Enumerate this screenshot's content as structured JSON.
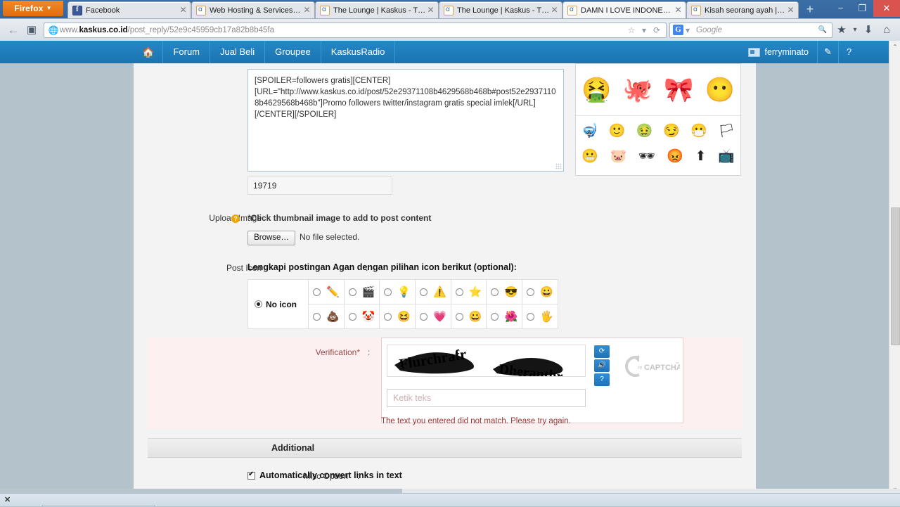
{
  "browser": {
    "menu_button": "Firefox",
    "menu_caret": "▼",
    "tabs": [
      {
        "title": "Facebook",
        "favicon": "facebook-icon",
        "active": false
      },
      {
        "title": "Web Hosting & Services |...",
        "favicon": "kaskus-icon",
        "active": false
      },
      {
        "title": "The Lounge | Kaskus - Th...",
        "favicon": "kaskus-icon",
        "active": false
      },
      {
        "title": "The Lounge | Kaskus - Th...",
        "favicon": "kaskus-icon",
        "active": false
      },
      {
        "title": "DAMN I LOVE INDONESI...",
        "favicon": "kaskus-icon",
        "active": true
      },
      {
        "title": "Kisah seorang ayah | Kas...",
        "favicon": "kaskus-icon",
        "active": false
      }
    ],
    "tab_close_glyph": "✕",
    "new_tab_label": "+",
    "window_minimize": "−",
    "window_restore": "❐",
    "window_close": "✕",
    "back_glyph": "←",
    "url_prefix": "www.",
    "url_domain": "kaskus.co.id",
    "url_path": "/post_reply/52e9c45959cb17a82b8b45fa",
    "bookmark_star": "☆",
    "bookmark_caret": "▾",
    "reload_glyph": "⟳",
    "search_engine": "G",
    "search_caret": "▾",
    "search_placeholder": "Google",
    "search_glyph": "🔍",
    "bookmarks_glyph": "★",
    "bookmarks_caret": "▾",
    "downloads_glyph": "⬇",
    "home_glyph": "⌂"
  },
  "site_header": {
    "home_icon": "🏠",
    "nav_items": [
      "Forum",
      "Jual Beli",
      "Groupee",
      "KaskusRadio"
    ],
    "user_name": "ferryminato",
    "edit_glyph": "✎",
    "help_glyph": "?"
  },
  "post_form": {
    "message_text": "[SPOILER=followers gratis][CENTER][URL=\"http://www.kaskus.co.id/post/52e29371108b4629568b468b#post52e29371108b4629568b468b\"]Promo followers twitter/instagram gratis special imlek[/URL][/CENTER][/SPOILER]",
    "char_count": "19719",
    "upload": {
      "label": "Upload Image",
      "help_glyph": "?",
      "colon": ":",
      "hint": "*Click thumbnail image to add to post content",
      "browse_label": "Browse…",
      "no_file_text": "No file selected."
    },
    "post_icon": {
      "label": "Post Icon",
      "colon": ":",
      "hint": "Lengkapi postingan Agan dengan pilihan icon berikut (optional):",
      "no_icon_label": "No icon",
      "row1": [
        "✏️",
        "🎬",
        "💡",
        "⚠️",
        "⭐",
        "😎",
        "😀"
      ],
      "row2": [
        "💩",
        "🤡",
        "😆",
        "💗",
        "😀",
        "🌺",
        "🖐️"
      ]
    },
    "verification": {
      "label": "Verification",
      "asterisk": "*",
      "colon": ":",
      "captcha_word_1": "Flurchrafr",
      "captcha_word_2": "Dheranthr",
      "input_placeholder": "Ketik teks",
      "refresh_glyph": "⟳",
      "audio_glyph": "🔊",
      "help_glyph": "?",
      "recaptcha_brand": "reCAPTCHA",
      "recaptcha_tm": "™",
      "error_text": "The text you entered did not match. Please try again."
    },
    "additional": {
      "section_title": "Additional",
      "misc_label": "Misc Option",
      "colon": ":",
      "misc_checkbox_checked": true,
      "misc_text": "Automatically convert links in text"
    }
  },
  "emoticon_panel": {
    "large": [
      "🤮",
      "🐙",
      "🎀",
      "😶"
    ],
    "small_row1": [
      "🤿",
      "🙂",
      "🤢",
      "😏",
      "😷",
      "🏳"
    ],
    "small_row2": [
      "😬",
      "🐷",
      "🕶",
      "😡",
      "⬆",
      "📺"
    ]
  },
  "scrollbar": {
    "up_glyph": "⌃",
    "down_glyph": "⌄"
  },
  "find_bar": {
    "close_glyph": "✕"
  }
}
